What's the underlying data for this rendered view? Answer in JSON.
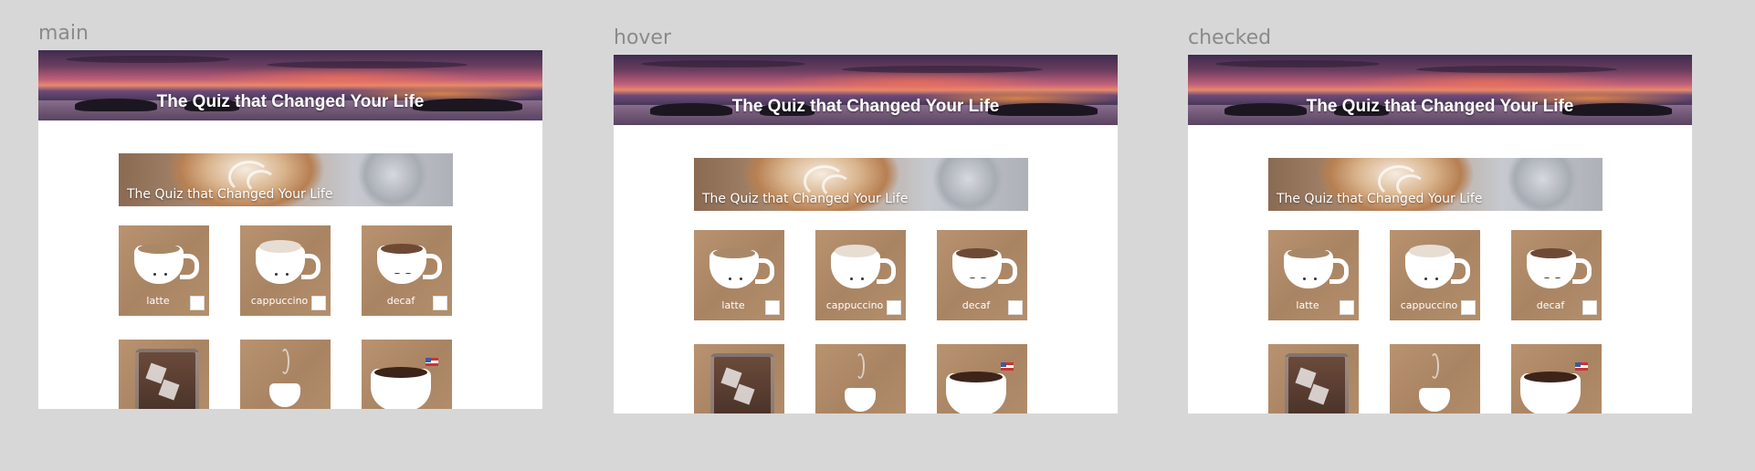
{
  "frames": [
    {
      "state": "main",
      "hero_title": "The Quiz that Changed Your Life",
      "banner_text": "The Quiz that Changed Your Life",
      "items": [
        {
          "label": "latte"
        },
        {
          "label": "cappuccino"
        },
        {
          "label": "decaf"
        }
      ]
    },
    {
      "state": "hover",
      "hero_title": "The Quiz that Changed Your Life",
      "banner_text": "The Quiz that Changed Your Life",
      "items": [
        {
          "label": "latte"
        },
        {
          "label": "cappuccino"
        },
        {
          "label": "decaf"
        }
      ]
    },
    {
      "state": "checked",
      "hero_title": "The Quiz that Changed Your Life",
      "banner_text": "The Quiz that Changed Your Life",
      "items": [
        {
          "label": "latte"
        },
        {
          "label": "cappuccino"
        },
        {
          "label": "decaf"
        }
      ]
    }
  ],
  "colors": {
    "page_bg": "#d7d7d7",
    "label_gray": "#8a8a8a",
    "kraft": "#b08a68",
    "accent_red": "#c72240"
  },
  "icons": [
    "latte-cup-icon",
    "cappuccino-cup-icon",
    "decaf-cup-icon",
    "iced-coffee-icon",
    "espresso-cup-icon",
    "americano-cup-icon"
  ]
}
